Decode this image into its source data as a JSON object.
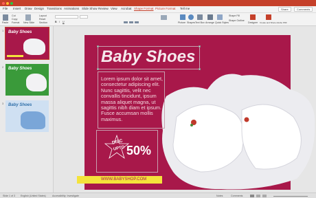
{
  "app": {
    "accent": "#c5402a"
  },
  "tabs": [
    "File",
    "Insert",
    "Draw",
    "Design",
    "Transitions",
    "Animations",
    "Slide Show",
    "Review",
    "View",
    "Acrobat",
    "Shape Format",
    "Picture Format",
    "Tell me"
  ],
  "share_label": "Share",
  "comments_label": "Comments",
  "ribbon": {
    "paste": "Paste",
    "cut": "Cut",
    "copy": "Copy",
    "format": "Format",
    "new_slide": "New Slide",
    "layout": "Layout",
    "reset": "Reset",
    "section": "Section",
    "picture": "Picture",
    "shapes": "Shapes",
    "text_box": "Text Box",
    "arrange": "Arrange",
    "quick_styles": "Quick Styles",
    "shape_fill": "Shape Fill",
    "shape_outline": "Shape Outline",
    "designer": "Designer",
    "create_share": "Create and Share Adobe PDF"
  },
  "thumbnails": [
    {
      "num": "1",
      "title": "Baby Shoes",
      "bg": "#a8184a",
      "title_color": "#ffffff"
    },
    {
      "num": "2",
      "title": "Baby Shoes",
      "bg": "#3a9a3a",
      "title_color": "#ffffff"
    },
    {
      "num": "3",
      "title": "Baby Shoes",
      "bg": "#cfe0f2",
      "title_color": "#2f6fa8"
    }
  ],
  "slide": {
    "title": "Baby Shoes",
    "body": "Lorem ipsum dolor sit amet, consectetur adipiscing elit. Nunc sagittis, velit nec convallis tincidunt, ipsum massa aliquet magna, ut sagittis nibh diam et ipsum. Fusce accumsan mollis maximus.",
    "badge_disc": "DISC",
    "badge_upto": "UPTO",
    "badge_pct": "50%",
    "url": "WWW.BABYSHOP.COM",
    "bg_color": "#a8184a",
    "url_bar_color": "#f4e33b"
  },
  "status": {
    "slide_info": "Slide 1 of 3",
    "language": "English (United States)",
    "accessibility": "Accessibility: Investigate",
    "notes": "Notes",
    "comments": "Comments"
  }
}
